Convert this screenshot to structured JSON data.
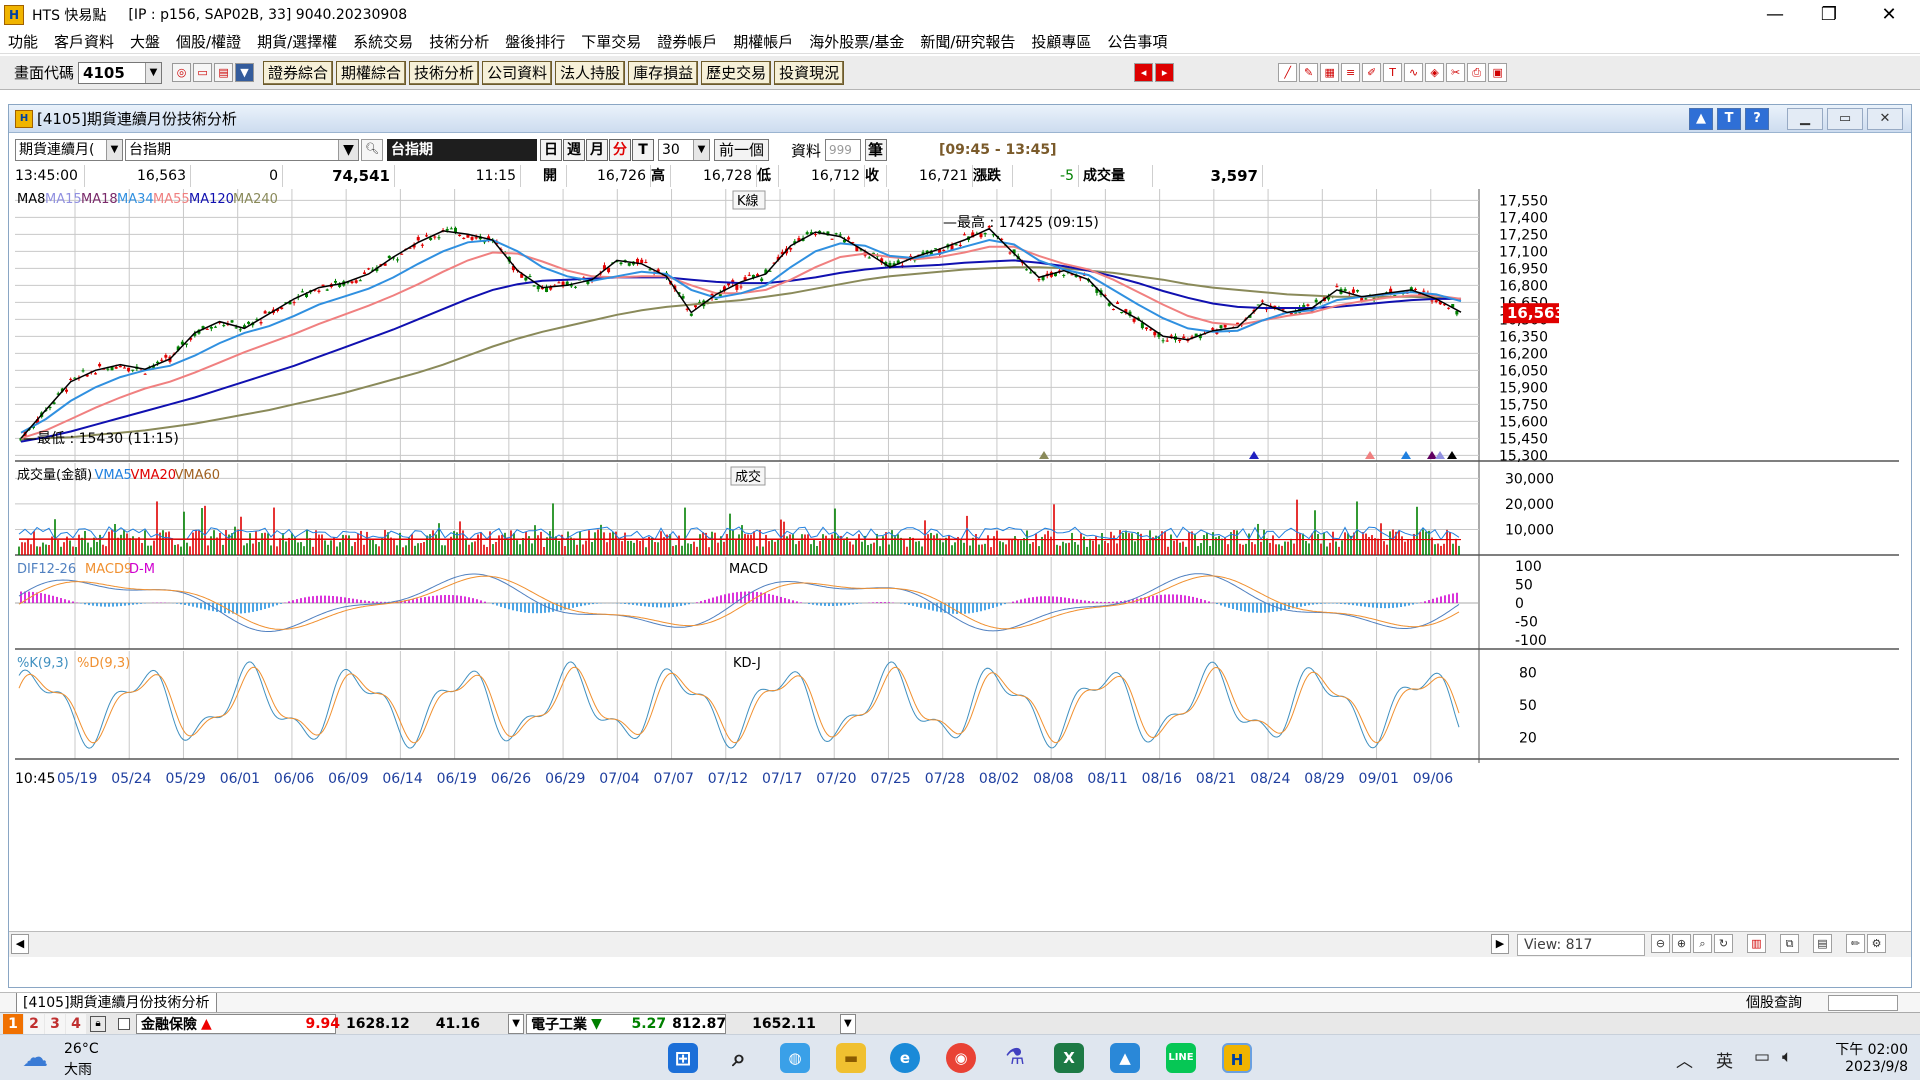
{
  "window": {
    "app_name": "HTS 快易點",
    "title_info": "[IP : p156, SAP02B, 33] 9040.20230908",
    "minimize": "—",
    "maximize": "❐",
    "close": "✕"
  },
  "menu": [
    "功能",
    "客戶資料",
    "大盤",
    "個股/權證",
    "期貨/選擇權",
    "系統交易",
    "技術分析",
    "盤後排行",
    "下單交易",
    "證券帳戶",
    "期權帳戶",
    "海外股票/基金",
    "新聞/研究報告",
    "投顧專區",
    "公告事項"
  ],
  "toolbar": {
    "code_label": "畫面代碼",
    "code_value": "4105",
    "buttons": [
      "證券綜合",
      "期權綜合",
      "技術分析",
      "公司資料",
      "法人持股",
      "庫存損益",
      "歷史交易",
      "投資現況"
    ]
  },
  "inner_window": {
    "title": "[4105]期貨連續月份技術分析"
  },
  "controls": {
    "contract_type": "期貨連續月(",
    "symbol": "台指期",
    "symbol_display": "台指期",
    "periods": [
      "日",
      "週",
      "月",
      "分",
      "T"
    ],
    "active_period": "分",
    "minutes": "30",
    "prev_button": "前一個",
    "data_label": "資料",
    "data_count": "999",
    "unit": "筆",
    "time_range": "[09:45 - 13:45]"
  },
  "quote": {
    "time": "13:45:00",
    "price": "16,563",
    "zero": "0",
    "volume_total": "74,541",
    "cursor_time": "11:15",
    "open_label": "開",
    "open": "16,726",
    "high_label": "高",
    "high": "16,728",
    "low_label": "低",
    "low": "16,712",
    "close_label": "收",
    "close": "16,721",
    "change_label": "漲跌",
    "change": "-5",
    "vol_label": "成交量",
    "vol": "3,597"
  },
  "panels": {
    "k_title": "K線",
    "k_legend": [
      {
        "label": "MA8",
        "color": "#000000"
      },
      {
        "label": "MA15",
        "color": "#9090e0"
      },
      {
        "label": "MA18",
        "color": "#7a2a6a"
      },
      {
        "label": "MA34",
        "color": "#3090e0"
      },
      {
        "label": "MA55",
        "color": "#f08080"
      },
      {
        "label": "MA120",
        "color": "#1010b0"
      },
      {
        "label": "MA240",
        "color": "#8a8a5a"
      }
    ],
    "k_high_note": "最高 : 17425 (09:15)",
    "k_low_note": "最低 : 15430 (11:15)",
    "current_price_tag": "16,563",
    "vol_title": "成交",
    "vol_legend": [
      {
        "label": "成交量(金額)",
        "color": "#000000"
      },
      {
        "label": "VMA5",
        "color": "#2080e0"
      },
      {
        "label": "VMA20",
        "color": "#e00000"
      },
      {
        "label": "VMA60",
        "color": "#a06020"
      }
    ],
    "macd_title": "MACD",
    "macd_legend": [
      {
        "label": "DIF12-26",
        "color": "#5080c0"
      },
      {
        "label": "MACD9",
        "color": "#f09030"
      },
      {
        "label": "D-M",
        "color": "#d000d0"
      }
    ],
    "kd_title": "KD-J",
    "kd_legend": [
      {
        "label": "%K(9,3)",
        "color": "#4090c0"
      },
      {
        "label": "%D(9,3)",
        "color": "#f09030"
      }
    ]
  },
  "chart_data": {
    "type": "line",
    "k_axis_ticks": [
      17550,
      17400,
      17250,
      17100,
      16950,
      16800,
      16650,
      16500,
      16350,
      16200,
      16050,
      15900,
      15750,
      15600,
      15450,
      15300
    ],
    "k_ylim": [
      15250,
      17650
    ],
    "vol_axis_ticks": [
      "30,000",
      "20,000",
      "10,000"
    ],
    "vol_ylim": [
      0,
      36000
    ],
    "macd_axis_ticks": [
      "100",
      "50",
      "0",
      "-50",
      "-100"
    ],
    "macd_ylim": [
      -125,
      125
    ],
    "kd_axis_ticks": [
      "80",
      "50",
      "20"
    ],
    "kd_ylim": [
      0,
      100
    ],
    "x_start_label": "10:45",
    "x_labels": [
      "05/19",
      "05/24",
      "05/29",
      "06/01",
      "06/06",
      "06/09",
      "06/14",
      "06/19",
      "06/26",
      "06/29",
      "07/04",
      "07/07",
      "07/12",
      "07/17",
      "07/20",
      "07/25",
      "07/28",
      "08/02",
      "08/08",
      "08/11",
      "08/16",
      "08/21",
      "08/24",
      "08/29",
      "09/01",
      "09/06"
    ],
    "price_path": [
      15450,
      15700,
      15950,
      16050,
      16100,
      16060,
      16150,
      16380,
      16480,
      16420,
      16550,
      16680,
      16780,
      16820,
      16900,
      17050,
      17180,
      17280,
      17250,
      17200,
      16930,
      16780,
      16800,
      16850,
      17020,
      16990,
      16880,
      16560,
      16720,
      16830,
      16900,
      17150,
      17270,
      17230,
      17100,
      16960,
      17050,
      17120,
      17200,
      17300,
      17080,
      16870,
      16930,
      16850,
      16620,
      16500,
      16350,
      16320,
      16400,
      16430,
      16640,
      16560,
      16600,
      16760,
      16700,
      16730,
      16760,
      16680,
      16563
    ],
    "ma34": [
      15500,
      15620,
      15780,
      15900,
      15990,
      16050,
      16090,
      16180,
      16290,
      16380,
      16440,
      16530,
      16630,
      16700,
      16770,
      16870,
      16990,
      17100,
      17180,
      17200,
      17100,
      16960,
      16880,
      16840,
      16880,
      16920,
      16900,
      16760,
      16690,
      16730,
      16800,
      16960,
      17100,
      17170,
      17150,
      17060,
      17040,
      17080,
      17140,
      17200,
      17160,
      17020,
      16940,
      16890,
      16760,
      16630,
      16510,
      16420,
      16390,
      16400,
      16490,
      16560,
      16580,
      16670,
      16700,
      16720,
      16740,
      16720,
      16660
    ],
    "ma55": [
      15450,
      15520,
      15620,
      15720,
      15810,
      15890,
      15950,
      16030,
      16120,
      16210,
      16290,
      16370,
      16460,
      16540,
      16620,
      16710,
      16810,
      16920,
      17020,
      17090,
      17080,
      17010,
      16930,
      16880,
      16870,
      16880,
      16880,
      16800,
      16730,
      16730,
      16760,
      16850,
      16960,
      17050,
      17080,
      17050,
      17030,
      17050,
      17090,
      17140,
      17140,
      17060,
      16990,
      16940,
      16850,
      16740,
      16630,
      16530,
      16470,
      16450,
      16490,
      16530,
      16560,
      16620,
      16660,
      16690,
      16710,
      16710,
      16680
    ],
    "ma120": [
      15420,
      15460,
      15510,
      15570,
      15630,
      15690,
      15750,
      15810,
      15880,
      15950,
      16020,
      16090,
      16170,
      16250,
      16330,
      16410,
      16500,
      16590,
      16680,
      16760,
      16810,
      16840,
      16850,
      16860,
      16870,
      16870,
      16870,
      16850,
      16830,
      16820,
      16820,
      16840,
      16870,
      16910,
      16940,
      16960,
      16970,
      16980,
      17000,
      17010,
      17020,
      17000,
      16970,
      16930,
      16880,
      16820,
      16750,
      16690,
      16640,
      16610,
      16600,
      16600,
      16600,
      16610,
      16630,
      16650,
      16670,
      16680,
      16680
    ],
    "ma240": [
      15440,
      15450,
      15460,
      15480,
      15500,
      15520,
      15550,
      15580,
      15620,
      15660,
      15700,
      15750,
      15800,
      15850,
      15910,
      15970,
      16030,
      16100,
      16180,
      16260,
      16330,
      16390,
      16440,
      16490,
      16540,
      16580,
      16610,
      16630,
      16650,
      16670,
      16700,
      16730,
      16770,
      16810,
      16850,
      16880,
      16900,
      16920,
      16940,
      16950,
      16960,
      16960,
      16950,
      16930,
      16910,
      16880,
      16850,
      16810,
      16780,
      16760,
      16740,
      16720,
      16710,
      16700,
      16700,
      16700,
      16700,
      16690,
      16680
    ]
  },
  "scroll": {
    "view_label": "View:",
    "view_value": "817"
  },
  "bottom_tab": {
    "tab": "[4105]期貨連續月份技術分析",
    "query": "個股查詢"
  },
  "ticker": {
    "tabs": [
      "1",
      "2",
      "3",
      "4"
    ],
    "item1_name": "金融保險",
    "item1_arrow": "▲",
    "item1_change": "9.94",
    "item1_price": "1628.12",
    "item1_extra": "41.16",
    "item2_name": "電子工業",
    "item2_arrow": "▼",
    "item2_change": "5.27",
    "item2_price": "812.87",
    "item2_extra": "1652.11"
  },
  "taskbar": {
    "weather_temp": "26°C",
    "weather_desc": "大雨",
    "ime": "英",
    "time": "下午 02:00",
    "date": "2023/9/8"
  }
}
